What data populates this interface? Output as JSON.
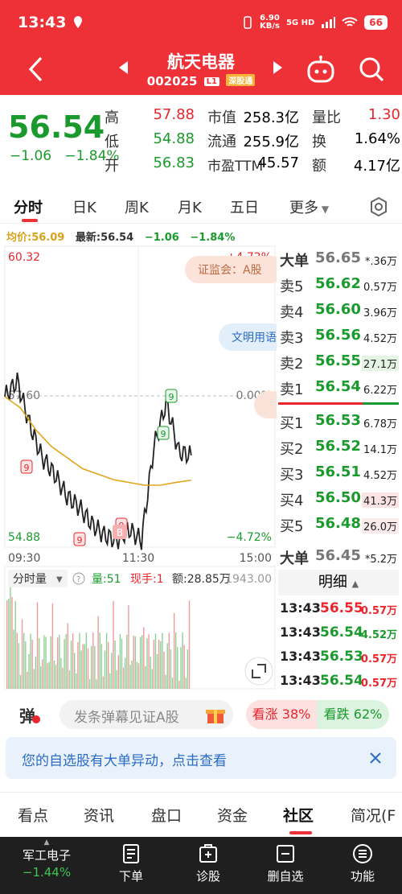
{
  "status": {
    "time": "13:43",
    "net_speed_top": "6.90",
    "net_speed_bottom": "KB/s",
    "net_type": "5G HD",
    "battery": "66"
  },
  "header": {
    "title": "航天电器",
    "code": "002025",
    "tag_l1": "L1",
    "tag_connect": "深股通"
  },
  "quote": {
    "price": "56.54",
    "change": "−1.06",
    "change_pct": "−1.84%",
    "high_label": "高",
    "high": "57.88",
    "low_label": "低",
    "low": "54.88",
    "open_label": "开",
    "open": "56.83",
    "mcap_label": "市值",
    "mcap": "258.3亿",
    "float_label": "流通",
    "float": "255.9亿",
    "pe_label": "市盈TTM",
    "pe": "45.57",
    "vr_label": "量比",
    "vr": "1.30",
    "turn_label": "换",
    "turn": "1.64%",
    "amt_label": "额",
    "amt": "4.17亿"
  },
  "tabs": [
    "分时",
    "日K",
    "周K",
    "月K",
    "五日",
    "更多"
  ],
  "infoline": {
    "avg_label": "均价:56.09",
    "latest": "最新:56.54",
    "chg": "−1.06",
    "pct": "−1.84%"
  },
  "chart": {
    "y_top": "60.32",
    "y_mid": "57.60",
    "y_bottom": "54.88",
    "pct_top": "+4.72%",
    "pct_mid": "0.00%",
    "pct_bottom": "−4.72%",
    "x_start": "09:30",
    "x_mid": "11:30",
    "x_end": "15:00",
    "news1": "证监会：A股",
    "news2": "文明用语",
    "vol_tab": "分时量",
    "vol_label": "量:51",
    "hand_label": "现手:1",
    "amt_label": "额:28.85万",
    "vol_max": "1943.00",
    "marker_9": "9",
    "marker_b": "B"
  },
  "chart_data": {
    "type": "line",
    "x": [
      "09:30",
      "11:30",
      "15:00"
    ],
    "series": [
      {
        "values": [
          57.6,
          57.88,
          57.1,
          56.5,
          56.2,
          55.8,
          55.6,
          55.3,
          55.1,
          55.0,
          55.2,
          55.0,
          56.7,
          57.5,
          56.6,
          56.54
        ]
      },
      {
        "values": [
          57.6,
          57.4,
          57.0,
          56.7,
          56.5,
          56.3,
          56.2,
          56.1,
          56.05,
          56.0,
          56.0,
          56.05,
          56.09
        ]
      }
    ],
    "ylim": [
      54.88,
      60.32
    ]
  },
  "orderbook": {
    "big_sell": {
      "label": "大单",
      "price": "56.65",
      "vol": "*.36万"
    },
    "asks": [
      {
        "label": "卖5",
        "price": "56.62",
        "vol": "0.57万"
      },
      {
        "label": "卖4",
        "price": "56.60",
        "vol": "3.96万"
      },
      {
        "label": "卖3",
        "price": "56.56",
        "vol": "4.52万"
      },
      {
        "label": "卖2",
        "price": "56.55",
        "vol": "27.1万"
      },
      {
        "label": "卖1",
        "price": "56.54",
        "vol": "6.22万"
      }
    ],
    "bids": [
      {
        "label": "买1",
        "price": "56.53",
        "vol": "6.78万"
      },
      {
        "label": "买2",
        "price": "56.52",
        "vol": "14.1万"
      },
      {
        "label": "买3",
        "price": "56.51",
        "vol": "4.52万"
      },
      {
        "label": "买4",
        "price": "56.50",
        "vol": "41.3万"
      },
      {
        "label": "买5",
        "price": "56.48",
        "vol": "26.0万"
      }
    ],
    "big_buy": {
      "label": "大单",
      "price": "56.45",
      "vol": "*5.2万"
    },
    "detail_title": "明细",
    "details": [
      {
        "time": "13:43",
        "price": "56.55",
        "vol": "0.57万"
      },
      {
        "time": "13:43",
        "price": "56.54",
        "vol": "4.52万"
      },
      {
        "time": "13:43",
        "price": "56.53",
        "vol": "0.57万"
      },
      {
        "time": "13:43",
        "price": "56.54",
        "vol": "0.57万"
      }
    ]
  },
  "danmu": {
    "icon": "弹",
    "placeholder": "发条弹幕见证A股",
    "up": "看涨 38%",
    "down": "看跌 62%"
  },
  "notice": {
    "text": "您的自选股有大单异动，点击查看"
  },
  "bottom_tabs": [
    "看点",
    "资讯",
    "盘口",
    "资金",
    "社区",
    "简况(F"
  ],
  "nav": {
    "sector": "军工电子",
    "sector_pct": "−1.44%",
    "order": "下单",
    "diag": "诊股",
    "remove": "删自选",
    "func": "功能"
  },
  "colors": {
    "red": "#e8262c",
    "green": "#1a9a2c",
    "header": "#ee3137"
  }
}
